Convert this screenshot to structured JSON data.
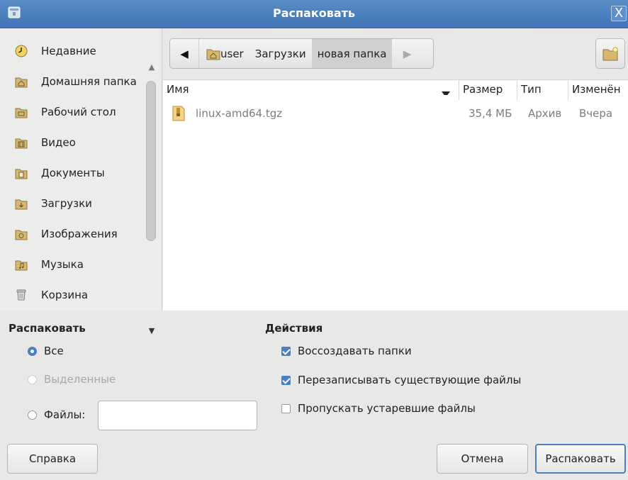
{
  "window": {
    "title": "Распаковать",
    "close_glyph": "X"
  },
  "sidebar": {
    "items": [
      {
        "label": "Недавние",
        "icon": "recent-icon"
      },
      {
        "label": "Домашняя папка",
        "icon": "home-folder-icon"
      },
      {
        "label": "Рабочий стол",
        "icon": "desktop-folder-icon"
      },
      {
        "label": "Видео",
        "icon": "videos-folder-icon"
      },
      {
        "label": "Документы",
        "icon": "documents-folder-icon"
      },
      {
        "label": "Загрузки",
        "icon": "downloads-folder-icon"
      },
      {
        "label": "Изображения",
        "icon": "pictures-folder-icon"
      },
      {
        "label": "Музыка",
        "icon": "music-folder-icon"
      },
      {
        "label": "Корзина",
        "icon": "trash-icon"
      }
    ]
  },
  "pathbar": {
    "segments": [
      "user",
      "Загрузки",
      "новая папка"
    ],
    "active_index": 2
  },
  "filelist": {
    "columns": [
      "Имя",
      "Размер",
      "Тип",
      "Изменён"
    ],
    "rows": [
      {
        "name": "linux-amd64.tgz",
        "size": "35,4 МБ",
        "type": "Архив",
        "modified": "Вчера"
      }
    ]
  },
  "extract": {
    "heading": "Распаковать",
    "options": [
      {
        "label": "Все",
        "selected": true,
        "enabled": true
      },
      {
        "label": "Выделенные",
        "selected": false,
        "enabled": false
      },
      {
        "label": "Файлы:",
        "selected": false,
        "enabled": true
      }
    ],
    "files_value": ""
  },
  "actions": {
    "heading": "Действия",
    "options": [
      {
        "label": "Воссоздавать папки",
        "checked": true
      },
      {
        "label": "Перезаписывать существующие файлы",
        "checked": true
      },
      {
        "label": "Пропускать устаревшие файлы",
        "checked": false
      }
    ]
  },
  "buttons": {
    "help": "Справка",
    "cancel": "Отмена",
    "extract": "Распаковать"
  },
  "colors": {
    "titlebar": "#4a7fc1",
    "accent": "#4a7fc1",
    "folder": "#d6b870"
  }
}
